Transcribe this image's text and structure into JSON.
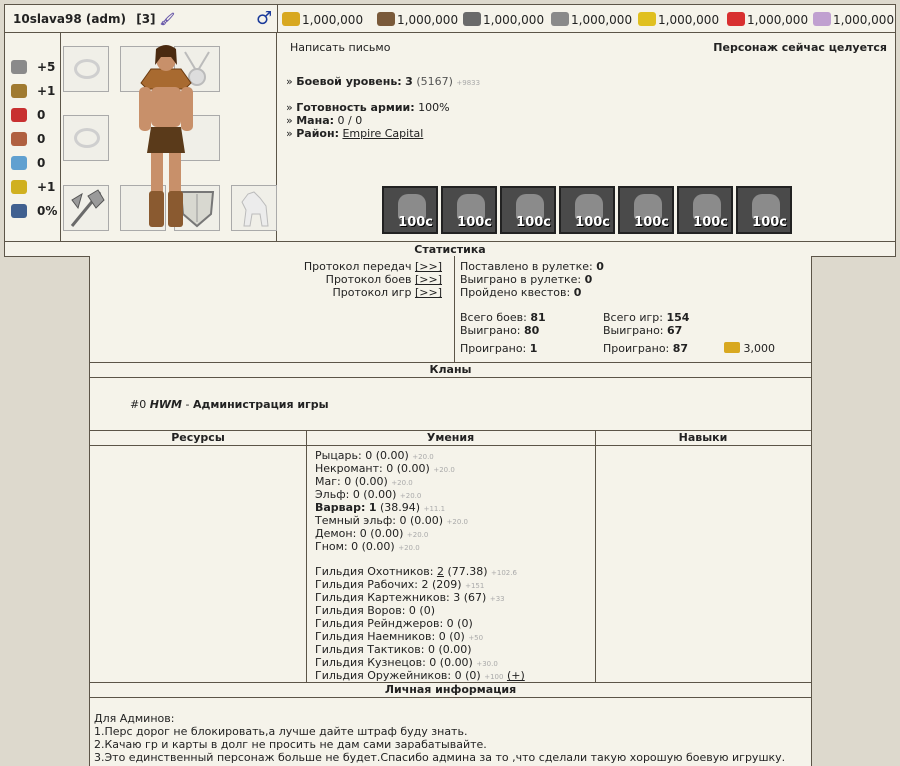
{
  "header": {
    "name": "10slava98 (adm)",
    "level_badge": "[3]",
    "gender_icon": "male-icon",
    "resources": [
      {
        "icon": "gold-icon",
        "value": "1,000,000",
        "color": "#d8a820"
      },
      {
        "icon": "wood-icon",
        "value": "1,000,000",
        "color": "#7a5a3a"
      },
      {
        "icon": "ore-icon",
        "value": "1,000,000",
        "color": "#6a6a6a"
      },
      {
        "icon": "mercury-icon",
        "value": "1,000,000",
        "color": "#8a8a8a"
      },
      {
        "icon": "sulfur-icon",
        "value": "1,000,000",
        "color": "#e0c020"
      },
      {
        "icon": "crystal-icon",
        "value": "1,000,000",
        "color": "#d83030"
      },
      {
        "icon": "gems-icon",
        "value": "1,000,000",
        "color": "#c0a0d0"
      }
    ]
  },
  "attributes": [
    {
      "icon": "attack-icon",
      "value": "+5"
    },
    {
      "icon": "defense-icon",
      "value": "+1"
    },
    {
      "icon": "spellpower-icon",
      "value": "0"
    },
    {
      "icon": "knowledge-icon",
      "value": "0"
    },
    {
      "icon": "luck-icon",
      "value": "0"
    },
    {
      "icon": "morale-icon",
      "value": "+1"
    },
    {
      "icon": "initiative-icon",
      "value": "0%"
    }
  ],
  "info": {
    "write_letter": "Написать письмо",
    "status": "Персонаж сейчас целуется",
    "combat_level_label": "Боевой уровень:",
    "combat_level": "3",
    "combat_exp": "(5167)",
    "combat_exp_next": "+9833",
    "army_label": "Готовность армии:",
    "army": "100%",
    "mana_label": "Мана:",
    "mana": "0 / 0",
    "district_label": "Район:",
    "district": "Empire Capital",
    "troops": [
      "100c",
      "100c",
      "100c",
      "100c",
      "100c",
      "100c",
      "100c"
    ]
  },
  "statistics_title": "Статистика",
  "protocols": {
    "transfers": "Протокол передач",
    "battles": "Протокол боев",
    "games": "Протокол игр",
    "link": "[>>]"
  },
  "stats": {
    "roulette_bet_label": "Поставлено в рулетке:",
    "roulette_bet": "0",
    "roulette_won_label": "Выиграно в рулетке:",
    "roulette_won": "0",
    "quests_label": "Пройдено квестов:",
    "quests": "0",
    "battles_total_label": "Всего боев:",
    "battles_total": "81",
    "battles_won_label": "Выиграно:",
    "battles_won": "80",
    "battles_lost_label": "Проиграно:",
    "battles_lost": "1",
    "games_total_label": "Всего игр:",
    "games_total": "154",
    "games_won_label": "Выиграно:",
    "games_won": "67",
    "games_lost_label": "Проиграно:",
    "games_lost": "87",
    "gold_value": "3,000"
  },
  "clans_title": "Кланы",
  "clan": {
    "num": "#0",
    "tag": "HWM",
    "dash": " - ",
    "name": "Администрация игры"
  },
  "columns": {
    "resources": "Ресурсы",
    "skills": "Умения",
    "talents": "Навыки"
  },
  "skills": [
    {
      "name": "Рыцарь:",
      "val": "0 (0.00)",
      "next": "+20.0"
    },
    {
      "name": "Некромант:",
      "val": "0 (0.00)",
      "next": "+20.0"
    },
    {
      "name": "Маг:",
      "val": "0 (0.00)",
      "next": "+20.0"
    },
    {
      "name": "Эльф:",
      "val": "0 (0.00)",
      "next": "+20.0"
    },
    {
      "name": "Варвар:",
      "val": "1",
      "val2": "(38.94)",
      "next": "+11.1"
    },
    {
      "name": "Темный эльф:",
      "val": "0 (0.00)",
      "next": "+20.0"
    },
    {
      "name": "Демон:",
      "val": "0 (0.00)",
      "next": "+20.0"
    },
    {
      "name": "Гном:",
      "val": "0 (0.00)",
      "next": "+20.0"
    }
  ],
  "guilds": [
    {
      "name": "Гильдия Охотников:",
      "val": "2",
      "val2": "(77.38)",
      "next": "+102.6"
    },
    {
      "name": "Гильдия Рабочих:",
      "val": "2 (209)",
      "next": "+151"
    },
    {
      "name": "Гильдия Картежников:",
      "val": "3 (67)",
      "next": "+33"
    },
    {
      "name": "Гильдия Воров:",
      "val": "0 (0)",
      "next": ""
    },
    {
      "name": "Гильдия Рейнджеров:",
      "val": "0 (0)",
      "next": ""
    },
    {
      "name": "Гильдия Наемников:",
      "val": "0 (0)",
      "next": "+50"
    },
    {
      "name": "Гильдия Тактиков:",
      "val": "0 (0.00)",
      "next": ""
    },
    {
      "name": "Гильдия Кузнецов:",
      "val": "0 (0.00)",
      "next": "+30.0"
    },
    {
      "name": "Гильдия Оружейников:",
      "val": "0 (0)",
      "next": "+100",
      "extra": "(+)"
    }
  ],
  "personal_title": "Личная информация",
  "personal": [
    "Для Админов:",
    "1.Перс дорог не блокировать,а лучше дайте штраф буду знать.",
    "2.Качаю гр и карты в долг не просить не дам сами зарабатывайте.",
    "3.Это единственный персонаж больше не будет.Спасибо админа за то ,что сделали такую хорошую боевую игрушку."
  ]
}
